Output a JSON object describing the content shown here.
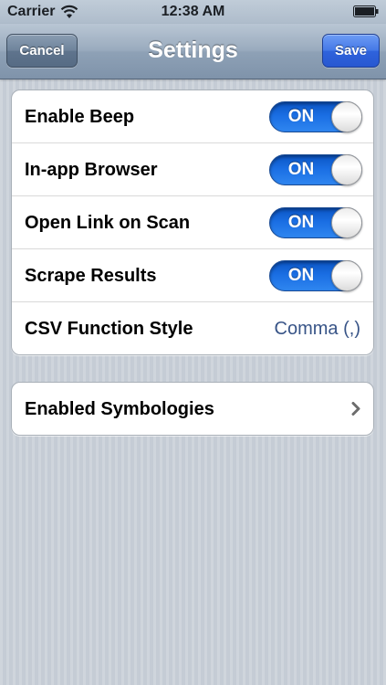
{
  "status_bar": {
    "carrier": "Carrier",
    "time": "12:38 AM",
    "wifi_icon": "wifi-icon",
    "battery_icon": "battery-icon"
  },
  "nav": {
    "title": "Settings",
    "cancel_label": "Cancel",
    "save_label": "Save",
    "save_color": "#3c6ee0"
  },
  "settings": {
    "rows": [
      {
        "label": "Enable Beep",
        "toggle": "ON"
      },
      {
        "label": "In-app Browser",
        "toggle": "ON"
      },
      {
        "label": "Open Link on Scan",
        "toggle": "ON"
      },
      {
        "label": "Scrape Results",
        "toggle": "ON"
      },
      {
        "label": "CSV Function Style",
        "value": "Comma (,)"
      }
    ]
  },
  "symbologies": {
    "label": "Enabled Symbologies",
    "icon": "chevron-right-icon"
  },
  "colors": {
    "toggle_on": "#1a6ee3",
    "value_text": "#385487",
    "background": "#c5ccd5"
  }
}
